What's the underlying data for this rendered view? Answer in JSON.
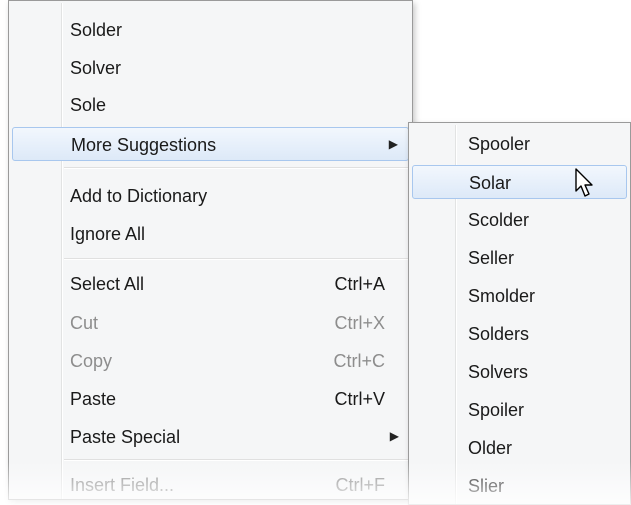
{
  "context_menu": {
    "items": [
      {
        "label": "Solder"
      },
      {
        "label": "Solver"
      },
      {
        "label": "Sole"
      },
      {
        "label": "More Suggestions"
      },
      {
        "label": "Add to Dictionary"
      },
      {
        "label": "Ignore All"
      },
      {
        "label": "Select All",
        "shortcut": "Ctrl+A"
      },
      {
        "label": "Cut",
        "shortcut": "Ctrl+X"
      },
      {
        "label": "Copy",
        "shortcut": "Ctrl+C"
      },
      {
        "label": "Paste",
        "shortcut": "Ctrl+V"
      },
      {
        "label": "Paste Special"
      },
      {
        "label": "Insert Field...",
        "shortcut": "Ctrl+F"
      }
    ]
  },
  "submenu": {
    "items": [
      {
        "label": "Spooler"
      },
      {
        "label": "Solar"
      },
      {
        "label": "Scolder"
      },
      {
        "label": "Seller"
      },
      {
        "label": "Smolder"
      },
      {
        "label": "Solders"
      },
      {
        "label": "Solvers"
      },
      {
        "label": "Spoiler"
      },
      {
        "label": "Older"
      },
      {
        "label": "Slier"
      }
    ]
  },
  "icons": {
    "submenu_arrow": "chevron-right-icon",
    "cursor": "mouse-pointer-icon"
  },
  "colors": {
    "highlight_border": "#a8c7ee",
    "disabled_text": "#8d8d8d",
    "menu_background": "#f5f6f7"
  }
}
